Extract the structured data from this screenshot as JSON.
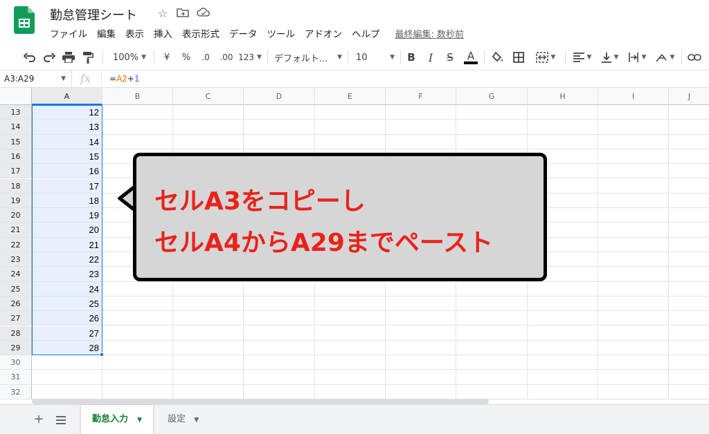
{
  "app": {
    "title": "勤怠管理シート",
    "last_edit": "最終編集: 数秒前",
    "menu": [
      "ファイル",
      "編集",
      "表示",
      "挿入",
      "表示形式",
      "データ",
      "ツール",
      "アドオン",
      "ヘルプ"
    ]
  },
  "toolbar": {
    "zoom": "100%",
    "currency": "¥",
    "percent": "%",
    "decimal_decrease": ".0",
    "decimal_increase": ".00",
    "number_format": "123",
    "font_name": "デフォルト...",
    "font_size": "10",
    "bold": "B",
    "italic": "I",
    "strike": "S",
    "text_color": "A"
  },
  "formula_bar": {
    "name_box": "A3:A29",
    "fx": "fx",
    "formula_eq": "=",
    "formula_ref": "A2",
    "formula_plus": "+",
    "formula_num": "1"
  },
  "grid": {
    "columns": [
      "A",
      "B",
      "C",
      "D",
      "E",
      "F",
      "G",
      "H",
      "I",
      "J"
    ],
    "rows": [
      {
        "num": "13",
        "a": "12"
      },
      {
        "num": "14",
        "a": "13"
      },
      {
        "num": "15",
        "a": "14"
      },
      {
        "num": "16",
        "a": "15"
      },
      {
        "num": "17",
        "a": "16"
      },
      {
        "num": "18",
        "a": "17"
      },
      {
        "num": "19",
        "a": "18"
      },
      {
        "num": "20",
        "a": "19"
      },
      {
        "num": "21",
        "a": "20"
      },
      {
        "num": "22",
        "a": "21"
      },
      {
        "num": "23",
        "a": "22"
      },
      {
        "num": "24",
        "a": "23"
      },
      {
        "num": "25",
        "a": "24"
      },
      {
        "num": "26",
        "a": "25"
      },
      {
        "num": "27",
        "a": "26"
      },
      {
        "num": "28",
        "a": "27"
      },
      {
        "num": "29",
        "a": "28"
      },
      {
        "num": "30",
        "a": ""
      },
      {
        "num": "31",
        "a": ""
      },
      {
        "num": "32",
        "a": ""
      }
    ]
  },
  "callout": {
    "line1": "セルA3をコピーし",
    "line2": "セルA4からA29までペースト"
  },
  "sheets": {
    "tabs": [
      {
        "label": "勤怠入力",
        "active": true
      },
      {
        "label": "設定",
        "active": false
      }
    ]
  },
  "colors": {
    "accent": "#1a73e8",
    "sheets_green": "#188038",
    "callout_text": "#e8231c",
    "callout_bg": "#d6d6d6"
  }
}
